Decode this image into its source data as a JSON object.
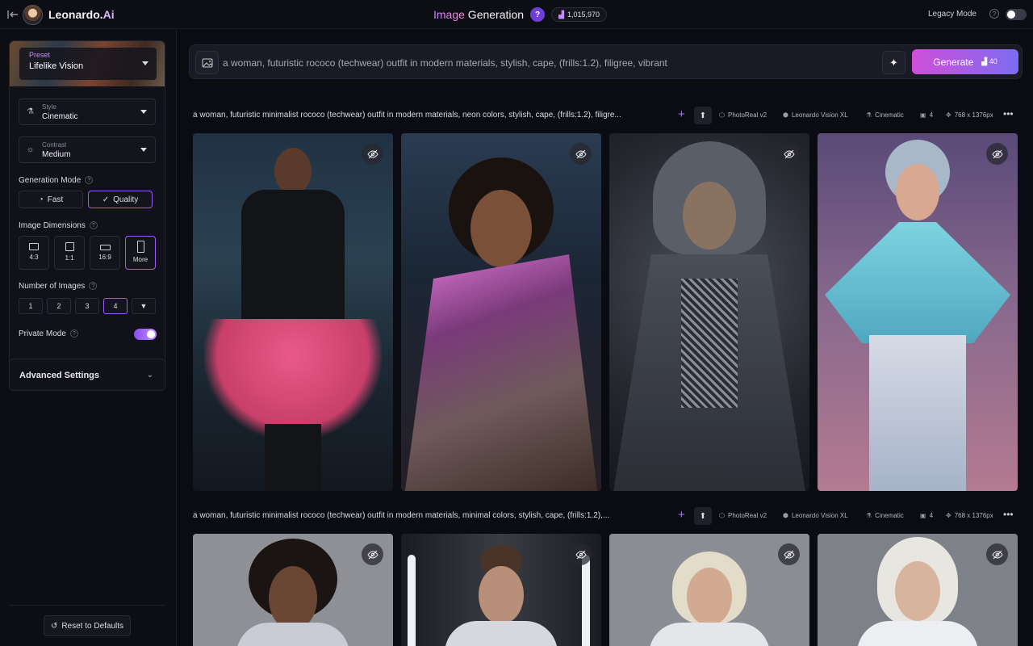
{
  "topbar": {
    "brand_main": "Leonardo.",
    "brand_suffix": "Ai",
    "title_highlight": "Image",
    "title_rest": " Generation",
    "help_glyph": "?",
    "token_count": "1,015,970",
    "legacy_mode_label": "Legacy Mode",
    "legacy_mode_on": false
  },
  "sidebar": {
    "preset": {
      "label": "Preset",
      "value": "Lifelike Vision"
    },
    "style": {
      "label": "Style",
      "value": "Cinematic"
    },
    "contrast": {
      "label": "Contrast",
      "value": "Medium"
    },
    "generation_mode": {
      "label": "Generation Mode",
      "options": [
        "Fast",
        "Quality"
      ],
      "selected": "Quality"
    },
    "image_dimensions": {
      "label": "Image Dimensions",
      "options": [
        "4:3",
        "1:1",
        "16:9",
        "More"
      ],
      "selected": "More"
    },
    "number_of_images": {
      "label": "Number of Images",
      "options": [
        "1",
        "2",
        "3",
        "4"
      ],
      "selected": "4"
    },
    "private_mode": {
      "label": "Private Mode",
      "enabled": true
    },
    "advanced_settings": "Advanced Settings",
    "reset": "Reset to Defaults"
  },
  "prompt_bar": {
    "text": "a woman, futuristic rococo (techwear) outfit in modern materials, stylish, cape, (frills:1.2), filigree, vibrant",
    "generate_label": "Generate",
    "generate_cost": "40"
  },
  "generations": [
    {
      "prompt": "a woman, futuristic minimalist rococo (techwear) outfit in modern materials, neon colors, stylish, cape, (frills:1.2), filigre...",
      "model": "PhotoReal v2",
      "base": "Leonardo Vision XL",
      "style": "Cinematic",
      "count": "4",
      "size": "768 x 1376px"
    },
    {
      "prompt": "a woman, futuristic minimalist rococo (techwear) outfit in modern materials, minimal colors, stylish, cape, (frills:1.2),...",
      "model": "PhotoReal v2",
      "base": "Leonardo Vision XL",
      "style": "Cinematic",
      "count": "4",
      "size": "768 x 1376px"
    }
  ],
  "colors": {
    "accent": "#9b5cf5",
    "generate_gradient_start": "#d04fd8",
    "generate_gradient_end": "#7d6cf0",
    "background": "#0b0c12"
  }
}
